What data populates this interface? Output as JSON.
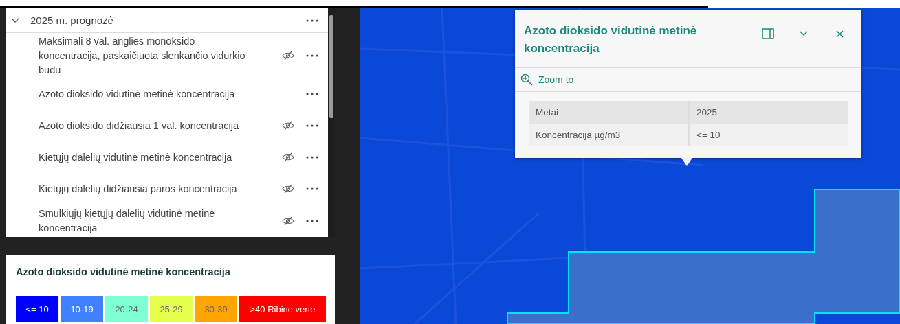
{
  "layer_group": {
    "title": "2025 m. prognozė",
    "expanded": true,
    "layers": [
      {
        "name": "Maksimali 8 val. anglies monoksido koncentracija, paskaičiuota slenkančio vidurkio būdu",
        "visible": false
      },
      {
        "name": "Azoto dioksido vidutinė metinė koncentracija",
        "visible": true
      },
      {
        "name": "Azoto dioksido didžiausia 1 val. koncentracija",
        "visible": false
      },
      {
        "name": "Kietųjų dalelių vidutinė metinė koncentracija",
        "visible": false
      },
      {
        "name": "Kietųjų dalelių didžiausia paros koncentracija",
        "visible": false
      },
      {
        "name": "Smulkiųjų kietųjų dalelių vidutinė metinė koncentracija",
        "visible": false
      }
    ]
  },
  "legend": {
    "title": "Azoto dioksido vidutinė metinė koncentracija",
    "classes": [
      {
        "label": "<= 10",
        "color": "#0000ff"
      },
      {
        "label": "10-19",
        "color": "#4080ff"
      },
      {
        "label": "20-24",
        "color": "#7fffd4"
      },
      {
        "label": "25-29",
        "color": "#e6ff4d"
      },
      {
        "label": "30-39",
        "color": "#ffa500"
      },
      {
        "label": ">40 Ribine verte",
        "color": "#ff0000"
      }
    ]
  },
  "popup": {
    "title": "Azoto dioksido vidutinė metinė koncentracija",
    "action": "Zoom to",
    "fields": [
      {
        "label": "Metai",
        "value": "2025"
      },
      {
        "label": "Koncentracija µg/m3",
        "value": "<= 10"
      }
    ]
  }
}
